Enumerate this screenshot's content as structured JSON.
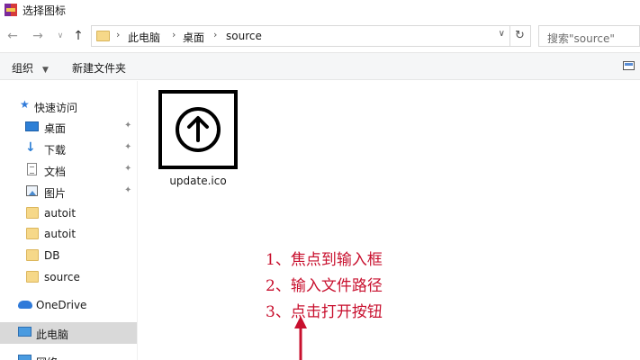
{
  "window": {
    "title": "选择图标"
  },
  "address": {
    "crumbs": [
      "此电脑",
      "桌面",
      "source"
    ],
    "search_placeholder": "搜索\"source\""
  },
  "nav": {
    "back_icon": "back-arrow-icon",
    "forward_icon": "forward-arrow-icon",
    "recent_icon": "chevron-down-icon",
    "up_icon": "up-arrow-icon",
    "refresh_icon": "refresh-icon"
  },
  "commands": {
    "organize": "组织",
    "new_folder": "新建文件夹"
  },
  "sidebar": {
    "quick_access": "快速访问",
    "items": [
      {
        "label": "桌面",
        "icon": "desktop-icon",
        "pinned": true
      },
      {
        "label": "下载",
        "icon": "download-icon",
        "pinned": true
      },
      {
        "label": "文档",
        "icon": "document-icon",
        "pinned": true
      },
      {
        "label": "图片",
        "icon": "picture-icon",
        "pinned": true
      },
      {
        "label": "autoit",
        "icon": "folder-icon",
        "pinned": false
      },
      {
        "label": "autoit",
        "icon": "folder-icon",
        "pinned": false
      },
      {
        "label": "DB",
        "icon": "folder-icon",
        "pinned": false
      },
      {
        "label": "source",
        "icon": "folder-icon",
        "pinned": false
      }
    ],
    "onedrive": "OneDrive",
    "this_pc": "此电脑",
    "network": "网络"
  },
  "files": [
    {
      "name": "update.ico",
      "icon": "upload-arrow-icon"
    }
  ],
  "annotations": [
    "1、焦点到输入框",
    "2、输入文件路径",
    "3、点击打开按钮"
  ],
  "colors": {
    "annotation": "#c8102e",
    "selected_bg": "#d9d9d9",
    "command_bar_bg": "#f5f6f7",
    "folder": "#f6d889",
    "accent": "#2f7ad9"
  }
}
